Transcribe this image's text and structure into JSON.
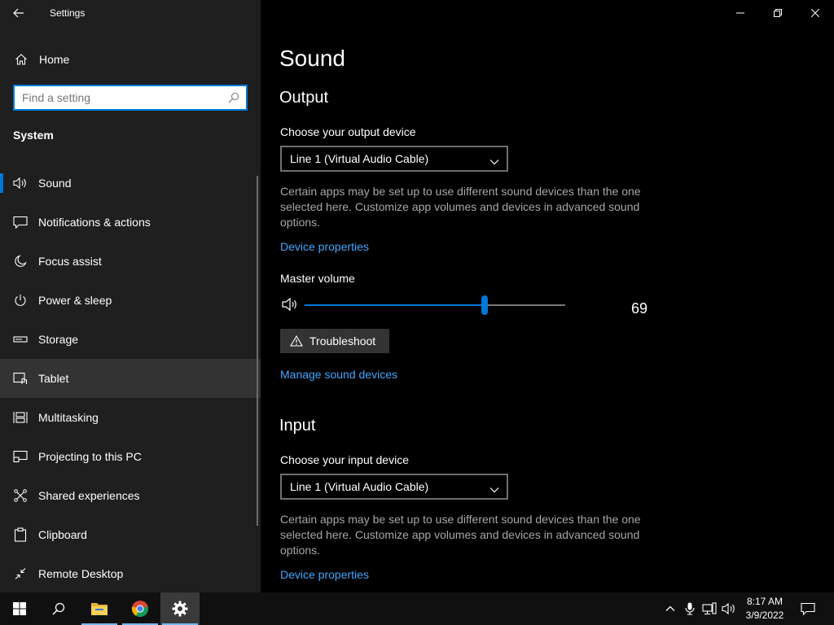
{
  "app": {
    "title": "Settings"
  },
  "sidebar": {
    "home_label": "Home",
    "search_placeholder": "Find a setting",
    "section_title": "System",
    "items": [
      {
        "label": "Sound",
        "icon": "speaker-icon",
        "selected": true
      },
      {
        "label": "Notifications & actions",
        "icon": "notification-icon"
      },
      {
        "label": "Focus assist",
        "icon": "moon-icon"
      },
      {
        "label": "Power & sleep",
        "icon": "power-icon"
      },
      {
        "label": "Storage",
        "icon": "storage-icon"
      },
      {
        "label": "Tablet",
        "icon": "tablet-icon",
        "hover": true
      },
      {
        "label": "Multitasking",
        "icon": "multitasking-icon"
      },
      {
        "label": "Projecting to this PC",
        "icon": "projecting-icon"
      },
      {
        "label": "Shared experiences",
        "icon": "shared-icon"
      },
      {
        "label": "Clipboard",
        "icon": "clipboard-icon"
      },
      {
        "label": "Remote Desktop",
        "icon": "remote-desktop-icon"
      }
    ]
  },
  "main": {
    "page_title": "Sound",
    "output": {
      "heading": "Output",
      "device_label": "Choose your output device",
      "device_value": "Line 1 (Virtual Audio Cable)",
      "description": "Certain apps may be set up to use different sound devices than the one selected here. Customize app volumes and devices in advanced sound options.",
      "device_properties_link": "Device properties",
      "master_volume_label": "Master volume",
      "volume": 69,
      "troubleshoot_label": "Troubleshoot",
      "manage_link": "Manage sound devices"
    },
    "input": {
      "heading": "Input",
      "device_label": "Choose your input device",
      "device_value": "Line 1 (Virtual Audio Cable)",
      "description": "Certain apps may be set up to use different sound devices than the one selected here. Customize app volumes and devices in advanced sound options.",
      "device_properties_link": "Device properties"
    }
  },
  "taskbar": {
    "time": "8:17 AM",
    "date": "3/9/2022"
  },
  "colors": {
    "accent": "#0078d7",
    "link": "#3ea6ff"
  }
}
